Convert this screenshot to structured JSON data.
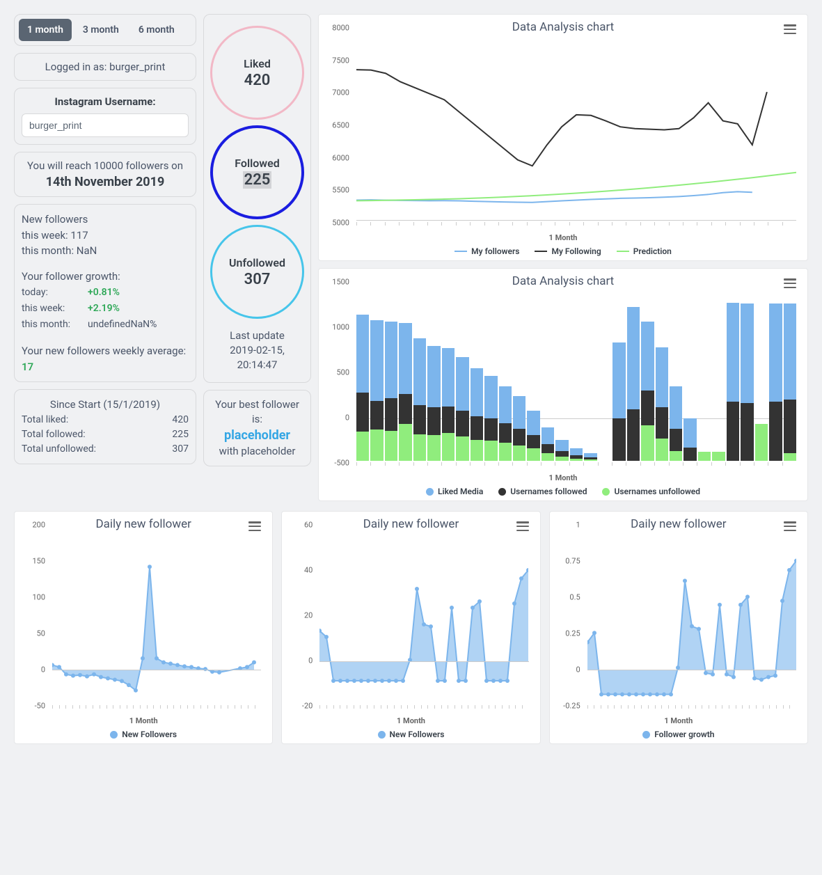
{
  "tabs": {
    "t1": "1 month",
    "t3": "3 month",
    "t6": "6 month"
  },
  "login": {
    "prefix": "Logged in as: ",
    "user": "burger_print"
  },
  "username_form": {
    "label": "Instagram Username:",
    "value": "burger_print"
  },
  "goal": {
    "prefix": "You will reach 10000 followers on",
    "date": "14th November 2019"
  },
  "newf": {
    "head": "New followers",
    "week_lbl": "this week: ",
    "week_val": "117",
    "month_lbl": "this month: ",
    "month_val": "NaN",
    "growth_head": "Your follower growth:",
    "today_k": "today:",
    "today_v": "+0.81%",
    "thisweek_k": "this week:",
    "thisweek_v": "+2.19%",
    "thismonth_k": "this month:",
    "thismonth_v": "undefinedNaN%",
    "avg_text": "Your new followers weekly average: ",
    "avg_val": "17"
  },
  "since": {
    "head": "Since Start (15/1/2019)",
    "liked_k": "Total liked:",
    "liked_v": "420",
    "followed_k": "Total followed:",
    "followed_v": "225",
    "unfollowed_k": "Total unfollowed:",
    "unfollowed_v": "307"
  },
  "circles": {
    "liked_lbl": "Liked",
    "liked_val": "420",
    "followed_lbl": "Followed",
    "followed_val": "225",
    "unfollowed_lbl": "Unfollowed",
    "unfollowed_val": "307"
  },
  "last_update": {
    "l1": "Last update",
    "l2": "2019-02-15,",
    "l3": "20:14:47"
  },
  "best": {
    "pre": "Your best follower is:",
    "name": "placeholder",
    "post": "with placeholder"
  },
  "chart_data": [
    {
      "id": "line1",
      "type": "line",
      "title": "Data Analysis chart",
      "xlabel": "1 Month",
      "ylim": [
        5000,
        8000
      ],
      "yticks": [
        5000,
        5500,
        6000,
        6500,
        7000,
        7500,
        8000
      ],
      "legend": [
        "My followers",
        "My Following",
        "Prediction"
      ],
      "colors": [
        "#7cb5ec",
        "#333333",
        "#90ed7d"
      ],
      "x_count": 31,
      "series": [
        {
          "name": "My followers",
          "values": [
            5330,
            5335,
            5328,
            5326,
            5323,
            5320,
            5322,
            5318,
            5312,
            5305,
            5300,
            5295,
            5292,
            5305,
            5318,
            5330,
            5342,
            5350,
            5360,
            5365,
            5370,
            5380,
            5390,
            5405,
            5425,
            5455,
            5470,
            5460,
            null,
            null,
            null
          ]
        },
        {
          "name": "My Following",
          "values": [
            7500,
            7495,
            7440,
            7300,
            7200,
            7100,
            7000,
            6800,
            6600,
            6400,
            6200,
            6000,
            5900,
            6250,
            6550,
            6750,
            6740,
            6650,
            6550,
            6520,
            6510,
            6500,
            6520,
            6700,
            6950,
            6650,
            6600,
            6250,
            7130,
            null,
            null
          ]
        },
        {
          "name": "Prediction",
          "values": [
            5320,
            5323,
            5327,
            5331,
            5336,
            5341,
            5347,
            5354,
            5362,
            5371,
            5381,
            5392,
            5404,
            5417,
            5431,
            5446,
            5462,
            5479,
            5497,
            5516,
            5536,
            5557,
            5579,
            5602,
            5626,
            5651,
            5677,
            5704,
            5732,
            5761,
            5790
          ]
        }
      ]
    },
    {
      "id": "bar1",
      "type": "bar",
      "title": "Data Analysis chart",
      "xlabel": "1 Month",
      "ylim": [
        -500,
        1500
      ],
      "yticks": [
        -500,
        0,
        500,
        1000,
        1500
      ],
      "legend": [
        "Liked Media",
        "Usernames followed",
        "Usernames unfollowed"
      ],
      "colors": [
        "#7cb5ec",
        "#333333",
        "#90ed7d"
      ],
      "x_count": 31,
      "series": [
        {
          "name": "Liked Media",
          "values": [
            700,
            720,
            690,
            640,
            600,
            550,
            520,
            480,
            430,
            380,
            330,
            290,
            220,
            150,
            100,
            60,
            40,
            0,
            680,
            920,
            620,
            540,
            380,
            260,
            0,
            0,
            890,
            890,
            0,
            880,
            860
          ]
        },
        {
          "name": "Usernames followed",
          "values": [
            350,
            260,
            290,
            270,
            260,
            250,
            240,
            230,
            210,
            200,
            180,
            150,
            120,
            80,
            50,
            30,
            20,
            0,
            380,
            460,
            310,
            280,
            200,
            120,
            0,
            0,
            530,
            520,
            0,
            530,
            480
          ]
        },
        {
          "name": "Usernames unfollowed",
          "values": [
            260,
            280,
            270,
            330,
            240,
            230,
            250,
            220,
            190,
            180,
            160,
            140,
            110,
            70,
            40,
            20,
            10,
            0,
            0,
            0,
            320,
            200,
            90,
            0,
            80,
            80,
            0,
            0,
            330,
            0,
            70
          ]
        }
      ]
    },
    {
      "id": "small1",
      "type": "area",
      "title": "Daily new follower",
      "xlabel": "1 Month",
      "ylim": [
        -50,
        200
      ],
      "yticks": [
        -50,
        0,
        50,
        100,
        150,
        200
      ],
      "legend": [
        "New Followers"
      ],
      "color": "#7cb5ec",
      "values": [
        8,
        5,
        -6,
        -8,
        -7,
        -9,
        -6,
        -10,
        -12,
        -14,
        -16,
        -22,
        -30,
        18,
        155,
        18,
        12,
        10,
        8,
        6,
        5,
        3,
        2,
        -2,
        -3,
        null,
        null,
        3,
        5,
        12,
        null
      ]
    },
    {
      "id": "small2",
      "type": "area",
      "title": "Daily new follower",
      "xlabel": "1 Month",
      "ylim": [
        -20,
        60
      ],
      "yticks": [
        -20,
        0,
        20,
        40,
        60
      ],
      "legend": [
        "New Followers"
      ],
      "color": "#7cb5ec",
      "values": [
        15,
        12,
        -9,
        -9,
        -9,
        -9,
        -9,
        -9,
        -9,
        -9,
        -9,
        -9,
        -9,
        1,
        35,
        18,
        17,
        -9,
        -9,
        26,
        -9,
        -9,
        26,
        29,
        -9,
        -9,
        -9,
        -9,
        28,
        40,
        44
      ]
    },
    {
      "id": "small3",
      "type": "area",
      "title": "Daily new follower",
      "xlabel": "1 Month",
      "ylim": [
        -0.25,
        1
      ],
      "yticks": [
        -0.25,
        0,
        0.25,
        0.5,
        0.75,
        1
      ],
      "legend": [
        "Follower growth"
      ],
      "color": "#7cb5ec",
      "values": [
        0.21,
        0.28,
        -0.18,
        -0.18,
        -0.18,
        -0.18,
        -0.18,
        -0.18,
        -0.18,
        -0.18,
        -0.18,
        -0.18,
        -0.18,
        0.02,
        0.67,
        0.33,
        0.31,
        -0.02,
        -0.03,
        0.49,
        -0.03,
        -0.05,
        0.49,
        0.55,
        -0.06,
        -0.07,
        -0.05,
        -0.04,
        0.52,
        0.75,
        0.82
      ]
    }
  ]
}
